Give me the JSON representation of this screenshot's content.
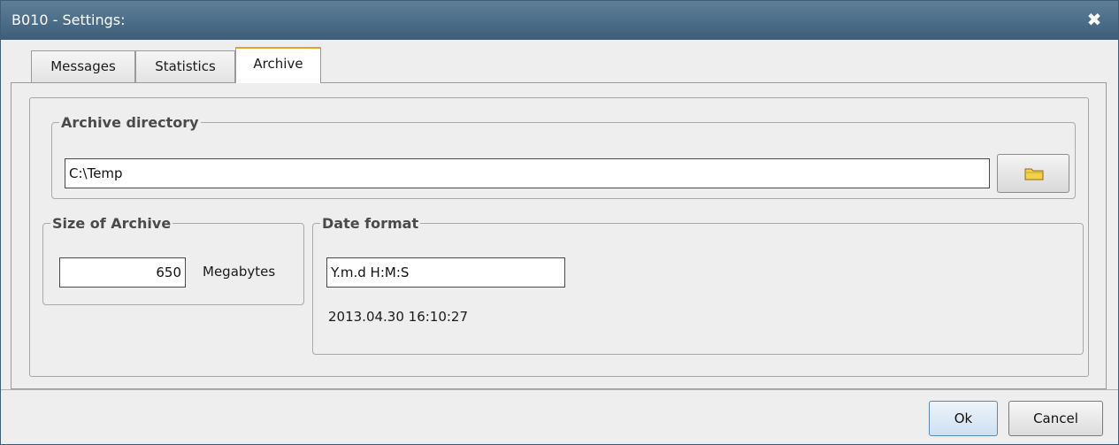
{
  "window": {
    "title": "B010 - Settings:",
    "close_glyph": "✖"
  },
  "tabs": [
    {
      "label": "Messages",
      "active": false
    },
    {
      "label": "Statistics",
      "active": false
    },
    {
      "label": "Archive",
      "active": true
    }
  ],
  "archive_directory": {
    "legend": "Archive directory",
    "value": "C:\\Temp",
    "browse_icon": "folder-icon"
  },
  "size_of_archive": {
    "legend": "Size of Archive",
    "value": "650",
    "unit": "Megabytes"
  },
  "date_format": {
    "legend": "Date format",
    "value": "Y.m.d H:M:S",
    "preview": "2013.04.30 16:10:27"
  },
  "buttons": {
    "ok": "Ok",
    "cancel": "Cancel"
  },
  "colors": {
    "titlebar": "#4a6b86",
    "active_tab_accent": "#e8a02a",
    "default_button": "#cfe0f2"
  }
}
